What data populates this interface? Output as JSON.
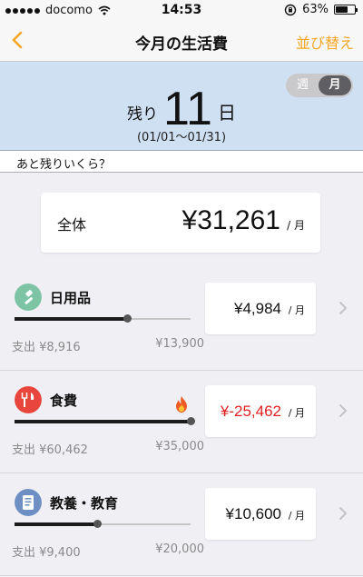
{
  "status_bar": {
    "carrier": "docomo",
    "time": "14:53",
    "battery": "63%",
    "battery_level": 0.63
  },
  "nav": {
    "title": "今月の生活費",
    "sort_label": "並び替え"
  },
  "period": {
    "week_label": "週",
    "month_label": "月",
    "selected": "月"
  },
  "days": {
    "prefix": "残り",
    "count": "11",
    "unit": "日",
    "range": "(01/01〜01/31)"
  },
  "section": {
    "header": "あと残りいくら？"
  },
  "total": {
    "label": "全体",
    "amount": "¥31,261",
    "unit": "/ 月"
  },
  "categories": [
    {
      "name": "日用品",
      "icon": "toothbrush-icon",
      "icon_color": "#7cc4a4",
      "spent": "支出 ¥8,916",
      "budget": "¥13,900",
      "level": 0.641,
      "amount": "¥4,984",
      "amount_color": "#111111",
      "unit": "/ 月",
      "over_budget": false
    },
    {
      "name": "食費",
      "icon": "fork-knife-icon",
      "icon_color": "#e8453c",
      "spent": "支出 ¥60,462",
      "budget": "¥35,000",
      "level": 1.0,
      "amount": "¥-25,462",
      "amount_color": "#e02020",
      "unit": "/ 月",
      "over_budget": true,
      "badge_icon": "fire-icon"
    },
    {
      "name": "教養・教育",
      "icon": "book-icon",
      "icon_color": "#6e8fc4",
      "spent": "支出 ¥9,400",
      "budget": "¥20,000",
      "level": 0.47,
      "amount": "¥10,600",
      "amount_color": "#111111",
      "unit": "/ 月",
      "over_budget": false
    }
  ],
  "colors": {
    "accent": "#f5a623",
    "header_bg": "#cfe0f3",
    "negative": "#e02020"
  }
}
